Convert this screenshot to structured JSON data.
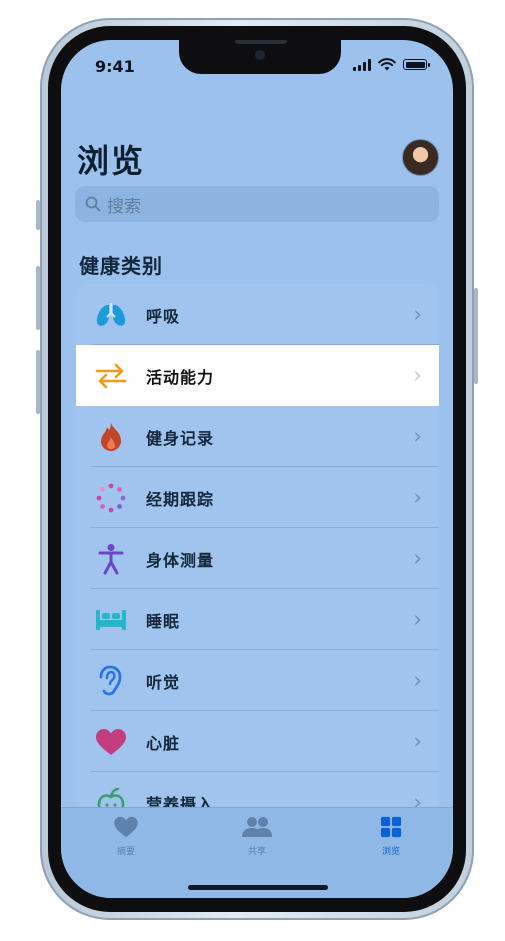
{
  "status_bar": {
    "time": "9:41"
  },
  "header": {
    "title": "浏览"
  },
  "search": {
    "placeholder": "搜索"
  },
  "section": {
    "title": "健康类别"
  },
  "categories": [
    {
      "label": "呼吸",
      "icon": "lungs-icon",
      "color": "#1b9bd8"
    },
    {
      "label": "活动能力",
      "icon": "arrows-icon",
      "color": "#f29b1b"
    },
    {
      "label": "健身记录",
      "icon": "flame-icon",
      "color": "#c0452a"
    },
    {
      "label": "经期跟踪",
      "icon": "cycle-dots-icon",
      "color": "#c64aa4"
    },
    {
      "label": "身体测量",
      "icon": "person-icon",
      "color": "#6a46c9"
    },
    {
      "label": "睡眠",
      "icon": "bed-icon",
      "color": "#2ab3c9"
    },
    {
      "label": "听觉",
      "icon": "ear-icon",
      "color": "#2874e8"
    },
    {
      "label": "心脏",
      "icon": "heart-icon",
      "color": "#c33d7e"
    },
    {
      "label": "营养摄入",
      "icon": "apple-icon",
      "color": "#3a9e6e"
    }
  ],
  "tabbar": {
    "tabs": [
      {
        "label": "摘要",
        "icon": "heart-icon"
      },
      {
        "label": "共享",
        "icon": "people-icon"
      },
      {
        "label": "浏览",
        "icon": "grid-icon"
      }
    ],
    "active_color": "#0a63d6"
  }
}
